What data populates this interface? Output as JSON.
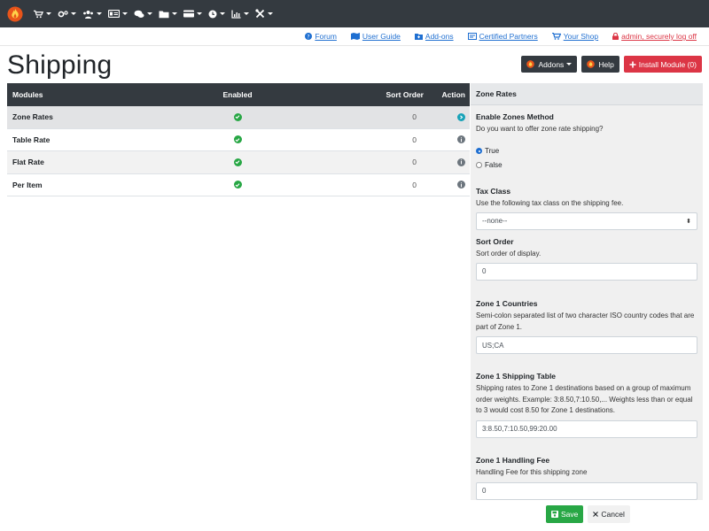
{
  "nav": {
    "icons": [
      "cart-icon",
      "gears-icon",
      "users-icon",
      "id-card-icon",
      "comments-icon",
      "folder-icon",
      "credit-card-icon",
      "clock-icon",
      "chart-icon",
      "tools-icon"
    ]
  },
  "links": {
    "forum": "Forum",
    "user_guide": "User Guide",
    "addons": "Add-ons",
    "certified_partners": "Certified Partners",
    "your_shop": "Your Shop",
    "logoff": "admin, securely log off"
  },
  "page": {
    "title": "Shipping"
  },
  "header_buttons": {
    "addons": "Addons",
    "help": "Help",
    "install": "Install Module (0)"
  },
  "table": {
    "columns": {
      "modules": "Modules",
      "enabled": "Enabled",
      "sort": "Sort Order",
      "action": "Action"
    },
    "rows": [
      {
        "name": "Zone Rates",
        "sort": "0",
        "action": "selected"
      },
      {
        "name": "Table Rate",
        "sort": "0",
        "action": "info"
      },
      {
        "name": "Flat Rate",
        "sort": "0",
        "action": "info"
      },
      {
        "name": "Per Item",
        "sort": "0",
        "action": "info"
      }
    ]
  },
  "panel": {
    "title": "Zone Rates",
    "enable_zones": {
      "label": "Enable Zones Method",
      "desc": "Do you want to offer zone rate shipping?",
      "opt_true": "True",
      "opt_false": "False",
      "selected": "True"
    },
    "tax_class": {
      "label": "Tax Class",
      "desc": "Use the following tax class on the shipping fee.",
      "value": "--none--"
    },
    "sort_order": {
      "label": "Sort Order",
      "desc": "Sort order of display.",
      "value": "0"
    },
    "zone1_countries": {
      "label": "Zone 1 Countries",
      "desc": "Semi-colon separated list of two character ISO country codes that are part of Zone 1.",
      "value": "US;CA"
    },
    "zone1_table": {
      "label": "Zone 1 Shipping Table",
      "desc": "Shipping rates to Zone 1 destinations based on a group of maximum order weights. Example: 3:8.50,7:10.50,... Weights less than or equal to 3 would cost 8.50 for Zone 1 destinations.",
      "value": "3:8.50,7:10.50,99:20.00"
    },
    "zone1_handling": {
      "label": "Zone 1 Handling Fee",
      "desc": "Handling Fee for this shipping zone",
      "value": "0"
    }
  },
  "footer": {
    "save": "Save",
    "cancel": "Cancel"
  },
  "colors": {
    "nav_bg": "#343a40",
    "link": "#1f6fd1",
    "danger": "#dc3545",
    "success": "#28a745",
    "info": "#17a2b8"
  }
}
